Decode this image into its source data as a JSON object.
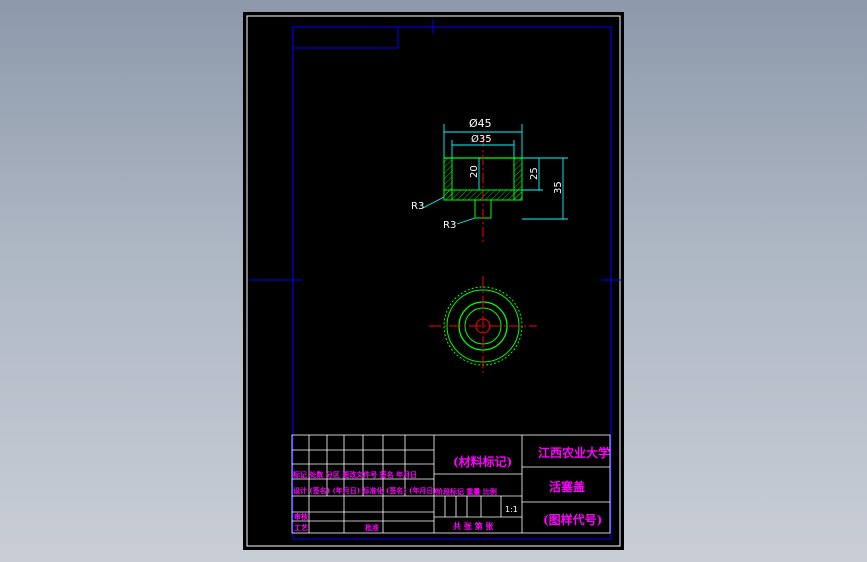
{
  "drawing": {
    "dimensions": {
      "outer_diameter": "Ø45",
      "inner_diameter": "Ø35",
      "depth_inner": "20",
      "depth_wall": "25",
      "total_height": "35",
      "fillet_left": "R3",
      "fillet_bottom": "R3"
    }
  },
  "title_block": {
    "material_mark": "(材料标记)",
    "university": "江西农业大学",
    "part_name": "活塞盖",
    "drawing_code": "(图样代号)",
    "row_header_1": "标记 处数 分区 更改文件号 签名 年月日",
    "row_header_2": "设计 (签名) (年月日) 标准化 (签名) (年月日)",
    "stage_header": "阶段标记 重量 比例",
    "scale": "1:1",
    "review": "审核",
    "process": "工艺",
    "approve": "批准",
    "sheets": "共 张 第 张"
  },
  "colors": {
    "frame": "#0000ff",
    "outline": "#00ff00",
    "dimension": "#00ffff",
    "hatch": "#00ff00",
    "centerline": "#ff0000",
    "text": "#ff00ff"
  }
}
